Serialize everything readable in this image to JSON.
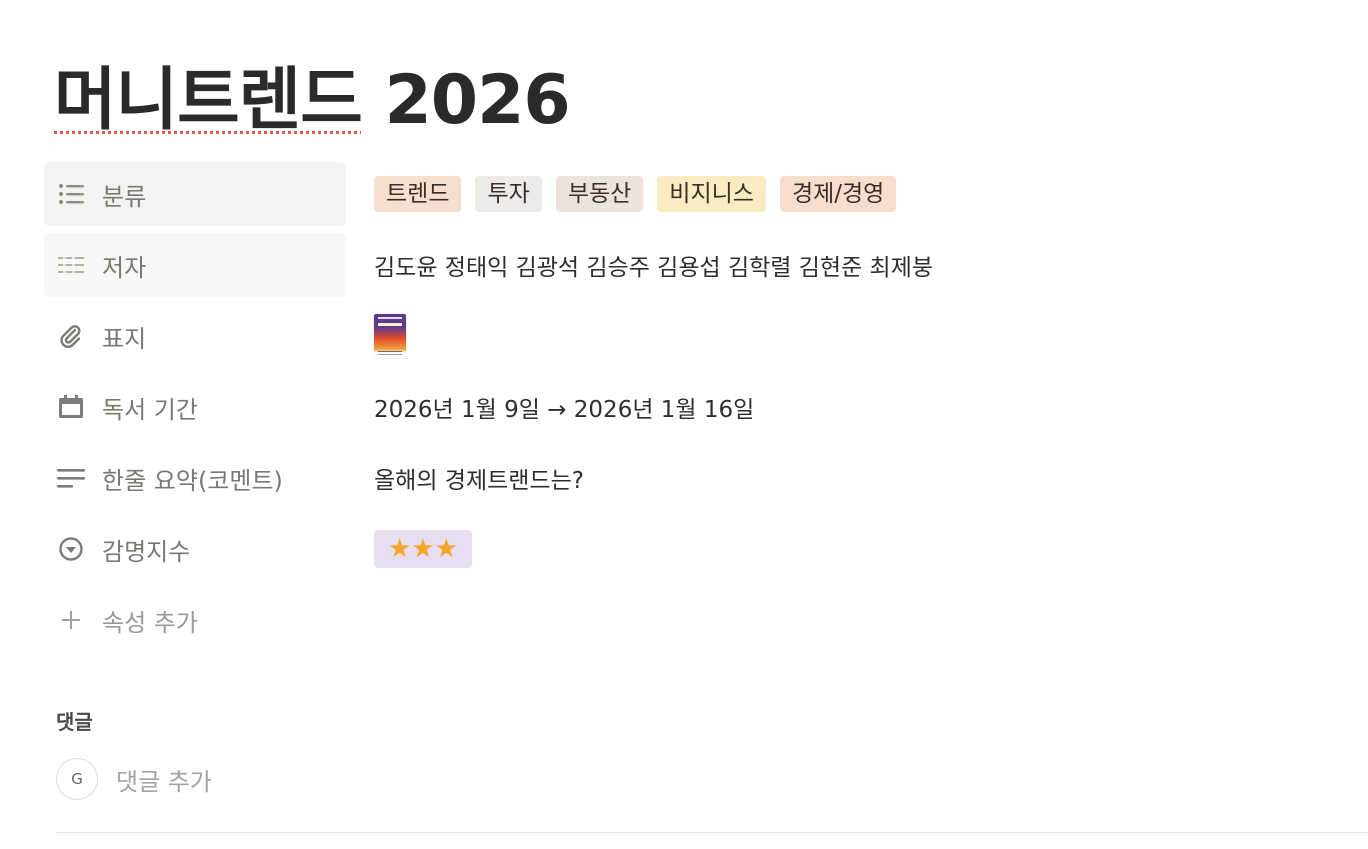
{
  "page": {
    "title_korean": "머니트렌드",
    "title_year": " 2026"
  },
  "properties": [
    {
      "label": "분류",
      "icon": "list-icon",
      "type": "multi-select",
      "tags": [
        {
          "label": "트렌드",
          "color": "#f7dfcf"
        },
        {
          "label": "투자",
          "color": "#ecebe8"
        },
        {
          "label": "부동산",
          "color": "#ede3de"
        },
        {
          "label": "비지니스",
          "color": "#f9ecc0"
        },
        {
          "label": "경제/경영",
          "color": "#f7ddce"
        }
      ]
    },
    {
      "label": "저자",
      "icon": "text-lines-icon",
      "type": "text",
      "value": "김도윤 정태익 김광석 김승주 김용섭 김학렬 김현준 최제붕"
    },
    {
      "label": "표지",
      "icon": "paperclip-icon",
      "type": "file",
      "value": "book-cover-thumbnail"
    },
    {
      "label": "독서 기간",
      "icon": "calendar-icon",
      "type": "date",
      "value": "2026년 1월 9일 → 2026년 1월 16일"
    },
    {
      "label": "한줄 요약(코멘트)",
      "icon": "paragraph-icon",
      "type": "text",
      "value": "올해의 경제트랜드는?"
    },
    {
      "label": "감명지수",
      "icon": "select-circle-icon",
      "type": "select",
      "value": "★★★",
      "color": "#e8def1"
    }
  ],
  "add_property": {
    "icon": "plus-icon",
    "label": "속성 추가"
  },
  "comments": {
    "heading": "댓글",
    "avatar_letter": "G",
    "placeholder": "댓글 추가"
  }
}
